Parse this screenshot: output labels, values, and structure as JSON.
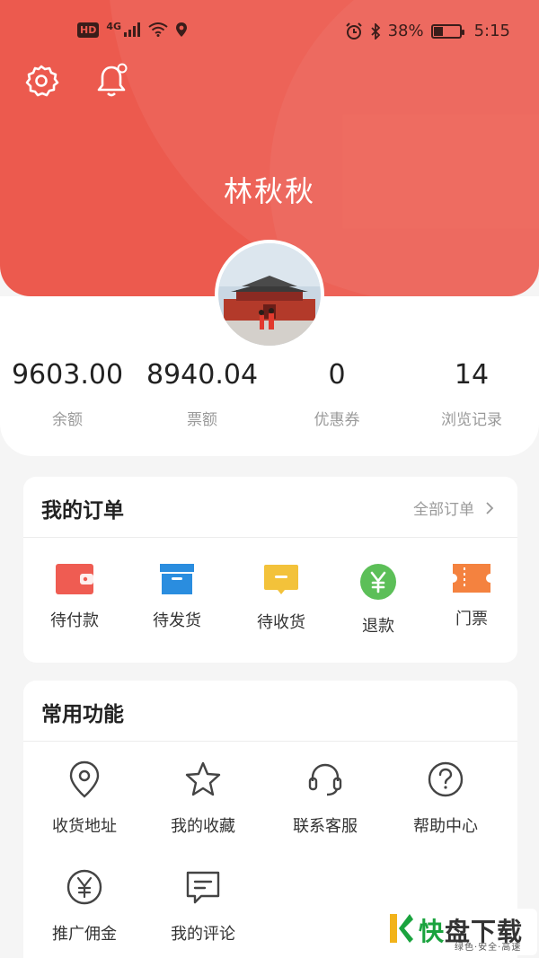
{
  "status_bar": {
    "left_badges": [
      "HD",
      "4G"
    ],
    "battery_percent": "38%",
    "battery_level": 0.38,
    "time": "5:15",
    "icons": [
      "signal-icon",
      "wifi-icon",
      "location-icon",
      "alarm-icon",
      "bluetooth-icon",
      "battery-icon"
    ]
  },
  "header": {
    "username": "林秋秋",
    "settings_icon": "gear-icon",
    "notification_icon": "bell-icon",
    "colors": {
      "primary": "#ec5a4e",
      "text_on_primary": "#ffffff"
    }
  },
  "stats": [
    {
      "value": "9603.00",
      "label": "余额"
    },
    {
      "value": "8940.04",
      "label": "票额"
    },
    {
      "value": "0",
      "label": "优惠券"
    },
    {
      "value": "14",
      "label": "浏览记录"
    }
  ],
  "orders": {
    "title": "我的订单",
    "all_orders": "全部订单",
    "items": [
      {
        "label": "待付款",
        "icon": "wallet-icon",
        "color": "#ef5c52"
      },
      {
        "label": "待发货",
        "icon": "box-icon",
        "color": "#2a8ddf"
      },
      {
        "label": "待收货",
        "icon": "message-box-icon",
        "color": "#f3c23a"
      },
      {
        "label": "退款",
        "icon": "yuan-circle-icon",
        "color": "#5cbf58"
      },
      {
        "label": "门票",
        "icon": "ticket-icon",
        "color": "#f4823f"
      }
    ]
  },
  "functions": {
    "title": "常用功能",
    "items": [
      {
        "label": "收货地址",
        "icon": "location-pin-icon"
      },
      {
        "label": "我的收藏",
        "icon": "star-icon"
      },
      {
        "label": "联系客服",
        "icon": "headset-icon"
      },
      {
        "label": "帮助中心",
        "icon": "question-circle-icon"
      },
      {
        "label": "推广佣金",
        "icon": "yuan-circle-icon"
      },
      {
        "label": "我的评论",
        "icon": "comment-icon"
      }
    ]
  },
  "watermark": {
    "main_a": "快",
    "main_b": "盘下载",
    "sub": "绿色·安全·高速"
  }
}
